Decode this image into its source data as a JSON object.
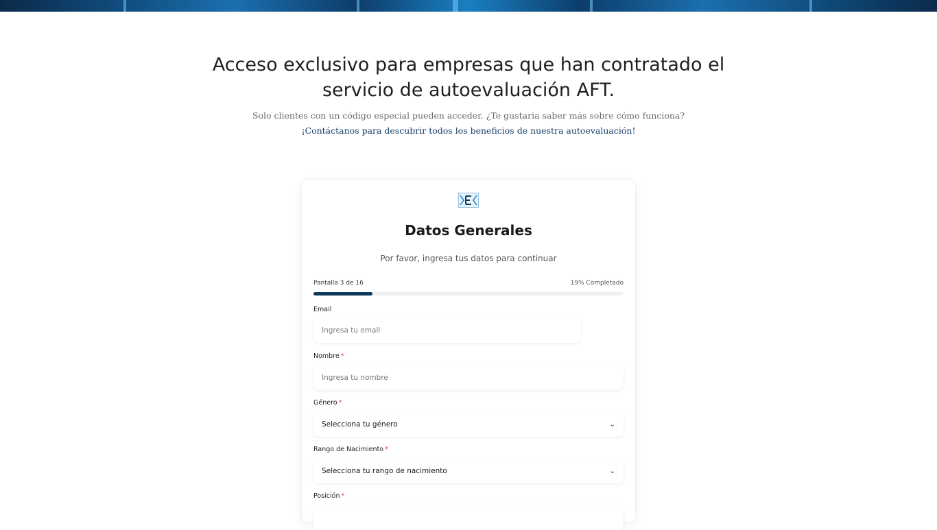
{
  "headline": "Acceso exclusivo para empresas que han contratado el servicio de autoevaluación AFT.",
  "subtext": "Solo clientes con un código especial pueden acceder. ¿Te gustaria saber más sobre cómo funciona?",
  "contact_link": "¡Contáctanos para descubrir todos los beneficios de nuestra autoevaluación!",
  "colors": {
    "accent": "#0e3b5c",
    "link": "#143f6b",
    "required": "#d64545"
  },
  "form": {
    "logo_icon": "e-logo-icon",
    "title": "Datos Generales",
    "subtitle": "Por favor, ingresa tus datos para continuar",
    "progress": {
      "label": "Pantalla 3 de 16",
      "percent_label": "19% Completado",
      "fraction": 0.19
    },
    "fields": {
      "email": {
        "label": "Email",
        "placeholder": "Ingresa tu email"
      },
      "nombre": {
        "label": "Nombre",
        "required": "*",
        "placeholder": "Ingresa tu nombre"
      },
      "genero": {
        "label": "Género",
        "required": "*",
        "value": "Selecciona tu género",
        "icon": "chevron-down-icon"
      },
      "rango": {
        "label": "Rango de Nacimiento",
        "required": "*",
        "value": "Selecciona tu rango de nacimiento",
        "icon": "chevron-down-icon"
      },
      "posicion": {
        "label": "Posición",
        "required": "*"
      }
    }
  }
}
